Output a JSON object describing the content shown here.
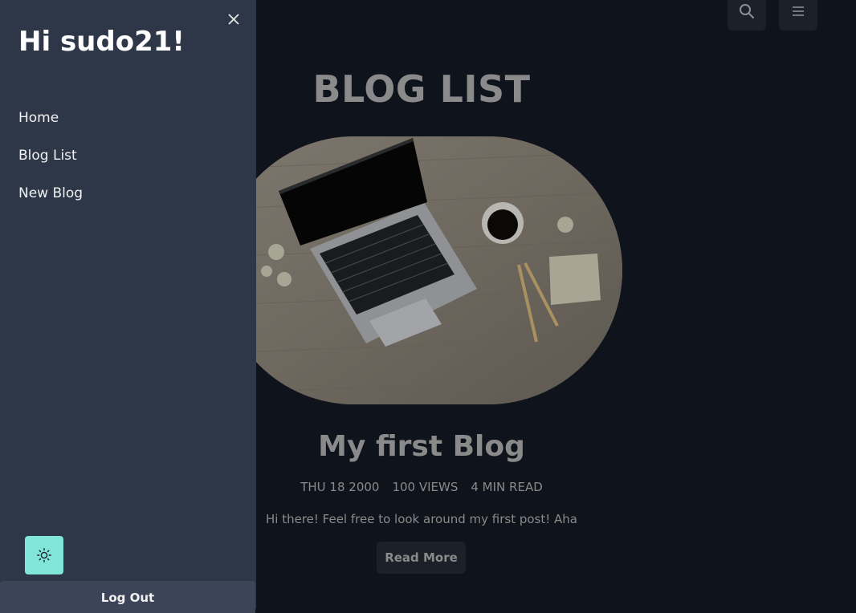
{
  "drawer": {
    "greeting": "Hi sudo21!",
    "nav": [
      {
        "label": "Home"
      },
      {
        "label": "Blog List"
      },
      {
        "label": "New Blog"
      }
    ],
    "logout_label": "Log Out",
    "theme_icon": "sun-icon",
    "close_icon": "close-icon"
  },
  "header": {
    "search_icon": "search-icon",
    "menu_icon": "hamburger-menu-icon"
  },
  "main": {
    "heading": "BLOG LIST",
    "post": {
      "title": "My first Blog",
      "date": "THU 18 2000",
      "views": "100 VIEWS",
      "read_time": "4 MIN READ",
      "excerpt": "Hi there! Feel free to look around my first post! Aha",
      "read_more_label": "Read More"
    }
  },
  "colors": {
    "drawer_bg": "#2e3748",
    "page_bg": "#0f131b",
    "accent": "#81e6d9",
    "logout_bg": "#3b4557"
  }
}
